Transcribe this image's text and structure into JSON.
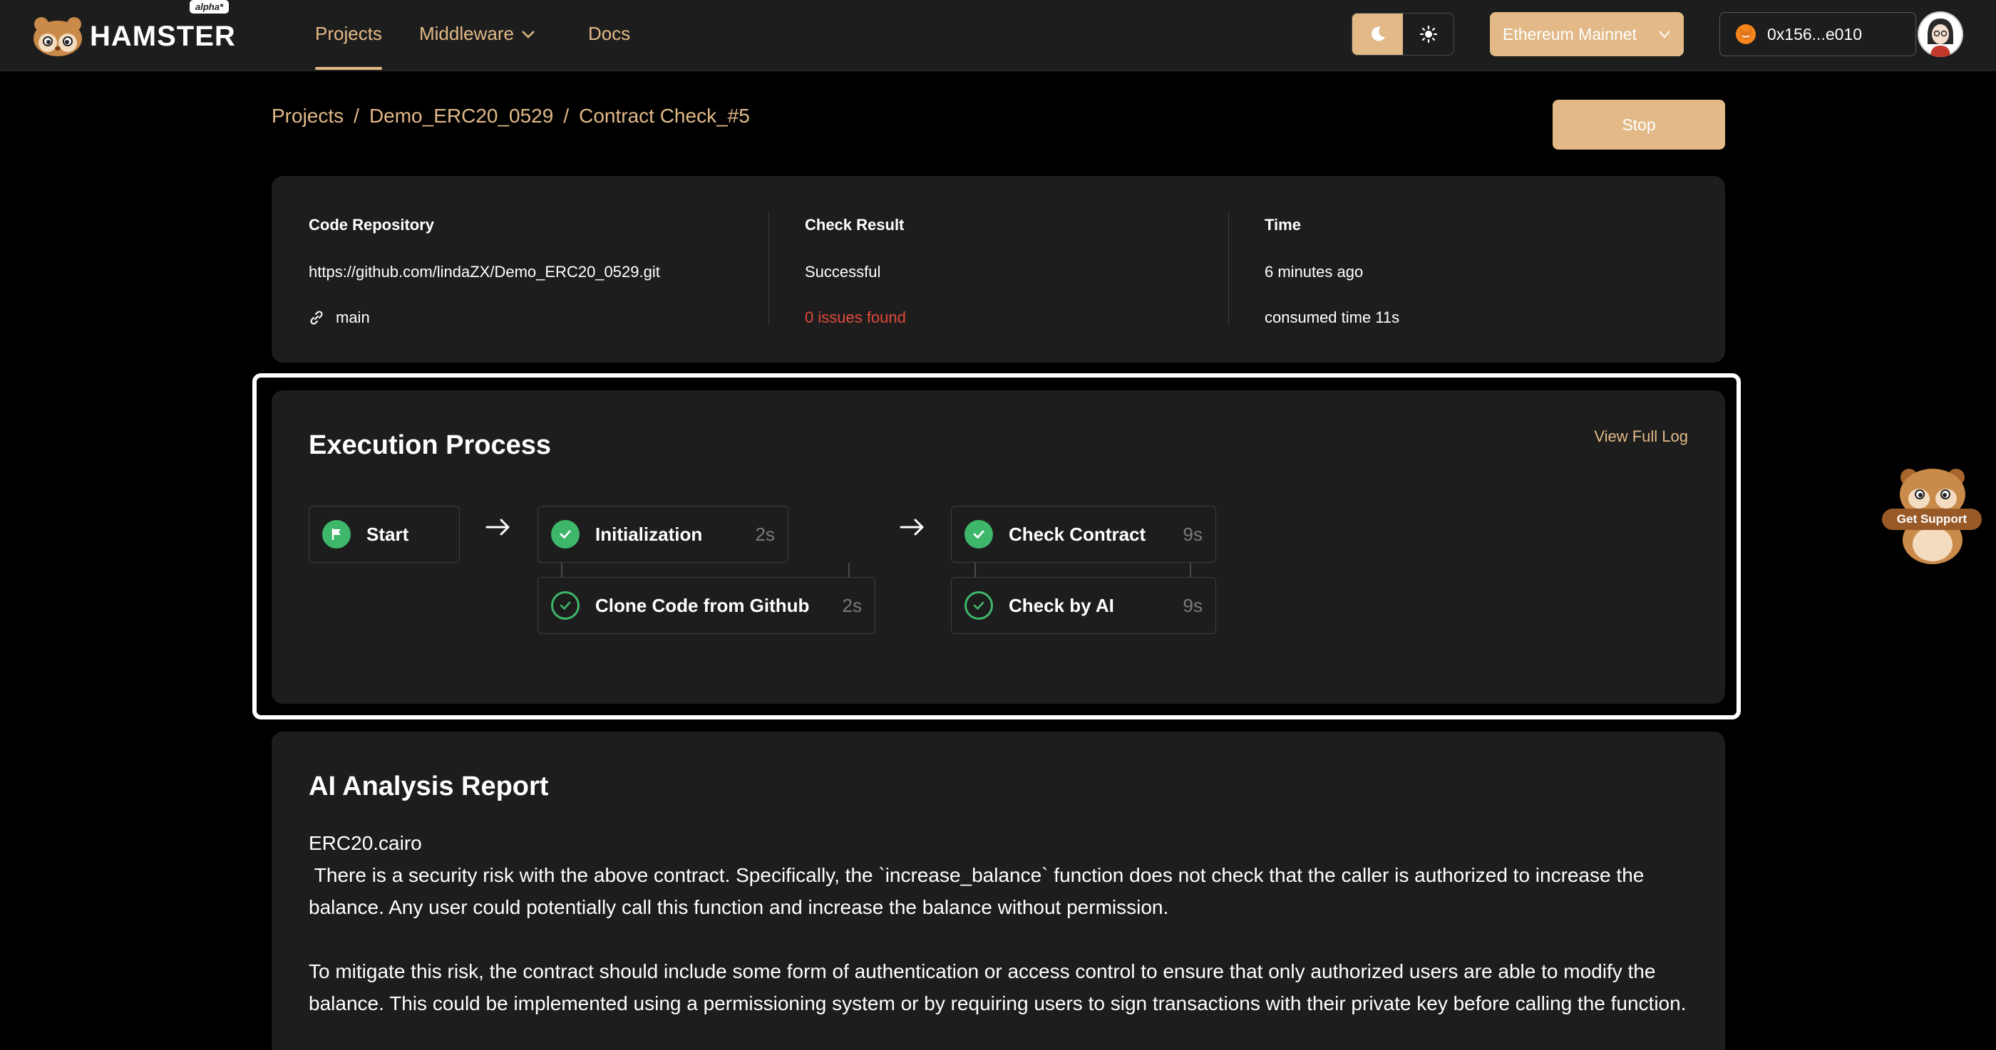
{
  "navbar": {
    "brand": "HAMSTER",
    "brand_badge": "alpha*",
    "links": [
      {
        "label": "Projects"
      },
      {
        "label": "Middleware"
      },
      {
        "label": "Docs"
      }
    ],
    "network": "Ethereum Mainnet",
    "wallet": "0x156...e010",
    "accent_color": "#e2b987"
  },
  "breadcrumb": [
    "Projects",
    "Demo_ERC20_0529",
    "Contract Check_#5"
  ],
  "stop_label": "Stop",
  "info": {
    "repo_title": "Code Repository",
    "repo_url": "https://github.com/lindaZX/Demo_ERC20_0529.git",
    "branch": "main",
    "result_title": "Check Result",
    "result_value": "Successful",
    "issues": "0 issues found",
    "time_title": "Time",
    "time_ago": "6 minutes ago",
    "consumed": "consumed time 11s"
  },
  "execution": {
    "title": "Execution Process",
    "view_log": "View Full Log",
    "start_label": "Start",
    "stages": [
      {
        "label": "Initialization",
        "time": "2s"
      },
      {
        "label": "Clone Code from Github",
        "time": "2s"
      },
      {
        "label": "Check Contract",
        "time": "9s"
      },
      {
        "label": "Check by AI",
        "time": "9s"
      }
    ]
  },
  "report": {
    "title": "AI Analysis Report",
    "file": "ERC20.cairo",
    "para1": " There is a security risk with the above contract. Specifically, the `increase_balance` function does not check that the caller is authorized to increase the balance. Any user could potentially call this function and increase the balance without permission.",
    "para2": "To mitigate this risk, the contract should include some form of authentication or access control to ensure that only authorized users are able to modify the balance. This could be implemented using a permissioning system or by requiring users to sign transactions with their private key before calling the function."
  },
  "support_label": "Get Support",
  "status_colors": {
    "success": "#3fb76b",
    "issues": "#e34a3c"
  }
}
